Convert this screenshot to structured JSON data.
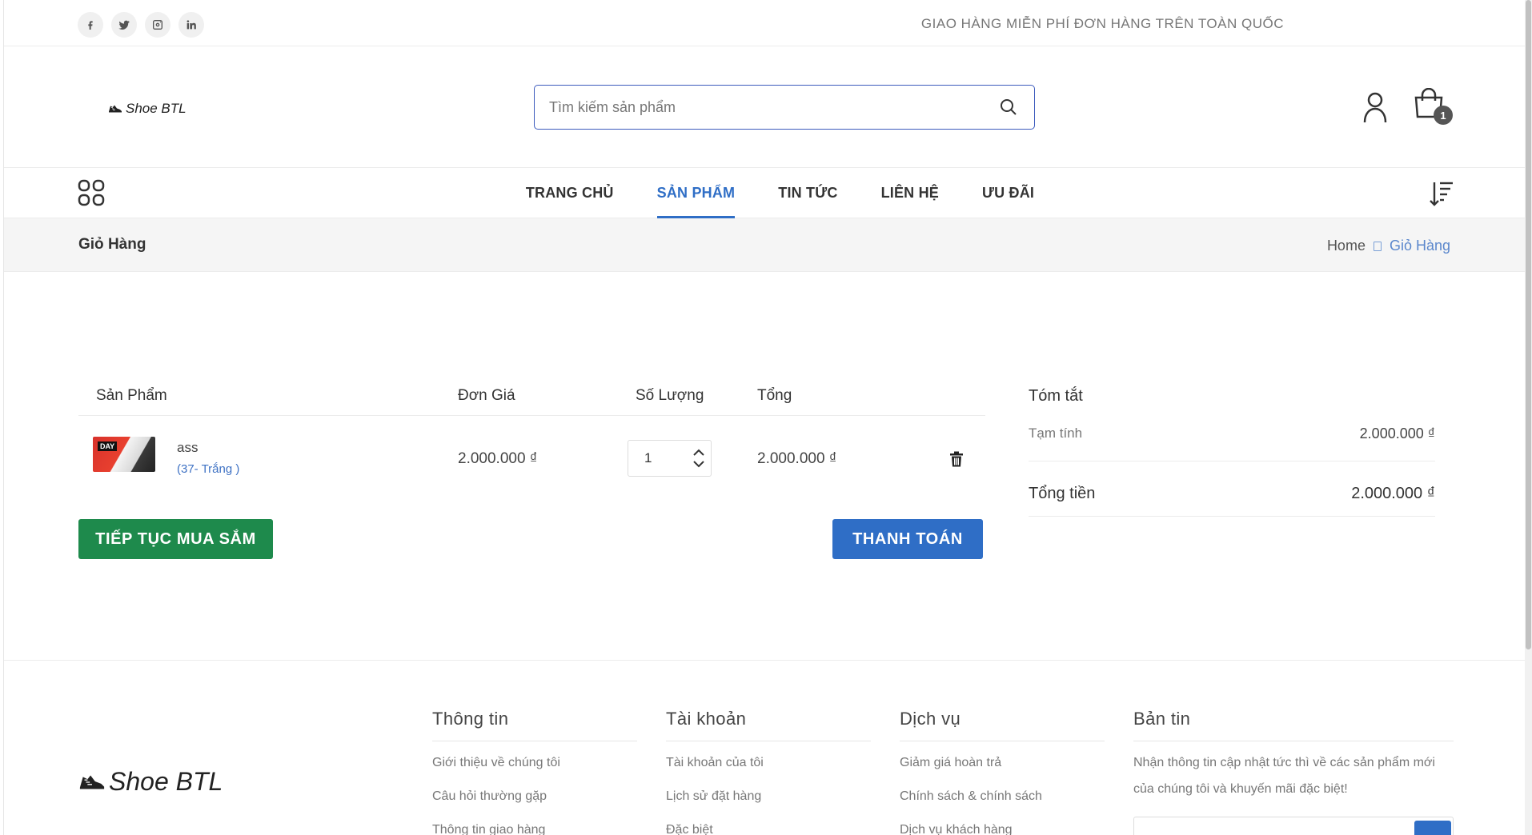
{
  "topbar": {
    "socials": [
      "facebook-icon",
      "twitter-icon",
      "instagram-icon",
      "linkedin-icon"
    ],
    "shipping_text": "GIAO HÀNG MIỄN PHÍ ĐƠN HÀNG TRÊN TOÀN QUỐC"
  },
  "header": {
    "logo_text": "Shoe BTL",
    "search_placeholder": "Tìm kiếm sản phẩm",
    "cart_count": "1"
  },
  "nav": {
    "items": [
      "TRANG CHỦ",
      "SẢN PHẨM",
      "TIN TỨC",
      "LIÊN HỆ",
      "ƯU ĐÃI"
    ],
    "active": "SẢN PHẨM"
  },
  "breadcrumb": {
    "title": "Giỏ Hàng",
    "home": "Home",
    "current": "Giỏ Hàng"
  },
  "cart": {
    "headers": {
      "product": "Sản Phẩm",
      "unit_price": "Đơn Giá",
      "quantity": "Số Lượng",
      "total": "Tổng"
    },
    "items": [
      {
        "name": "ass",
        "variant": "(37- Trắng )",
        "unit_price": "2.000.000 ₫",
        "quantity": "1",
        "total": "2.000.000 ₫"
      }
    ],
    "continue_label": "TIẾP TỤC MUA SẮM",
    "checkout_label": "THANH TOÁN"
  },
  "summary": {
    "title": "Tóm tắt",
    "subtotal_label": "Tạm tính",
    "subtotal_value": "2.000.000 ₫",
    "total_label": "Tổng tiền",
    "total_value": "2.000.000 ₫"
  },
  "footer": {
    "logo_text": "Shoe BTL",
    "info": {
      "title": "Thông tin",
      "links": [
        "Giới thiệu về chúng tôi",
        "Câu hỏi thường gặp",
        "Thông tin giao hàng"
      ]
    },
    "account": {
      "title": "Tài khoản",
      "links": [
        "Tài khoản của tôi",
        "Lịch sử đặt hàng",
        "Đặc biệt"
      ]
    },
    "services": {
      "title": "Dịch vụ",
      "links": [
        "Giảm giá hoàn trả",
        "Chính sách & chính sách",
        "Dịch vụ khách hàng"
      ]
    },
    "newsletter": {
      "title": "Bản tin",
      "text": "Nhận thông tin cập nhật tức thì về các sản phẩm mới của chúng tôi và khuyến mãi đặc biệt!"
    }
  },
  "colors": {
    "accent": "#2f6ec6",
    "continue_button": "#1e8a4c"
  }
}
